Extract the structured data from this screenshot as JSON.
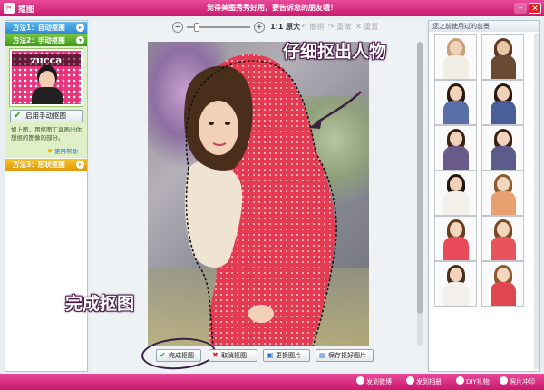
{
  "window": {
    "title": "抠图",
    "slogan": "觉得美图秀秀好用，要告诉您的朋友哦！",
    "minimize_glyph": "–",
    "close_glyph": "✕"
  },
  "left_panel": {
    "method1": {
      "label": "方法1：自动抠图",
      "arrow": "▸"
    },
    "method2": {
      "label": "方法2：手动抠图",
      "arrow": "▾",
      "thumb_brand": "zucca",
      "manual_button": "启用手动抠图",
      "description": "如上图，用抠图工具画出你想抠的图像的部分。",
      "help_link": "使用帮助"
    },
    "method3": {
      "label": "方法3：形状抠图",
      "arrow": "▸"
    }
  },
  "toolbar": {
    "zoom_out": "−",
    "zoom_in": "+",
    "original_size": "1:1 原大",
    "undo": "↶ 撤销",
    "redo": "↷ 重做",
    "reset": "✕ 重置"
  },
  "canvas": {
    "annotation_top": "仔细抠出人物",
    "annotation_bottom": "完成抠图"
  },
  "bottom_buttons": {
    "done": "完成抠图",
    "cancel": "取消抠图",
    "change_image": "更换图片",
    "save_cutout": "保存抠好图片"
  },
  "right_panel": {
    "header": "您之前使用过的前景",
    "items": [
      {
        "hair": "#c9a07a",
        "skin": "#f0d2b8",
        "body": "#f2ede4"
      },
      {
        "hair": "#5a3a26",
        "skin": "#e8c6a6",
        "body": "#6b4a34"
      },
      {
        "hair": "#2a1a12",
        "skin": "#f1d3bb",
        "body": "#5a6fa8"
      },
      {
        "hair": "#2a1a12",
        "skin": "#f1d3bb",
        "body": "#4a5f98"
      },
      {
        "hair": "#3a2418",
        "skin": "#f1d3bb",
        "body": "#6a5a8a"
      },
      {
        "hair": "#3a2418",
        "skin": "#f1d3bb",
        "body": "#5c5c8c"
      },
      {
        "hair": "#221610",
        "skin": "#f0d0b6",
        "body": "#f4f0ea"
      },
      {
        "hair": "#8a5a30",
        "skin": "#f3d6be",
        "body": "#e8a070"
      },
      {
        "hair": "#6a3a20",
        "skin": "#f3d6be",
        "body": "#e84a5a"
      },
      {
        "hair": "#7a4a28",
        "skin": "#f3d6be",
        "body": "#e8545e"
      },
      {
        "hair": "#4a2e1c",
        "skin": "#f1d3bb",
        "body": "#f3f0ec"
      },
      {
        "hair": "#8a5a30",
        "skin": "#f3d6be",
        "body": "#e04650"
      }
    ]
  },
  "statusbar": {
    "weibo": "发到微博",
    "album": "发到相册",
    "diy_gift": "DIY礼物",
    "photo_print": "照片冲印"
  }
}
